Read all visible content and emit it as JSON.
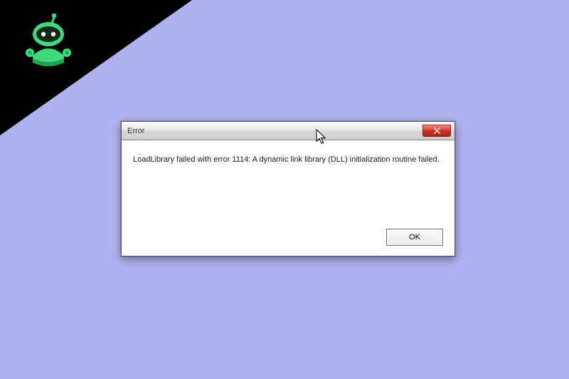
{
  "logo": {
    "name": "robot-logo"
  },
  "dialog": {
    "title": "Error",
    "message": "LoadLibrary failed with error 1114: A dynamic link library (DLL) initialization routine failed.",
    "ok_label": "OK",
    "close_icon": "close-x"
  },
  "colors": {
    "background": "#b0b1ef",
    "corner": "#000000",
    "robot_body": "#3fd87a",
    "robot_dark": "#1aa84e",
    "close_red": "#c83020"
  }
}
